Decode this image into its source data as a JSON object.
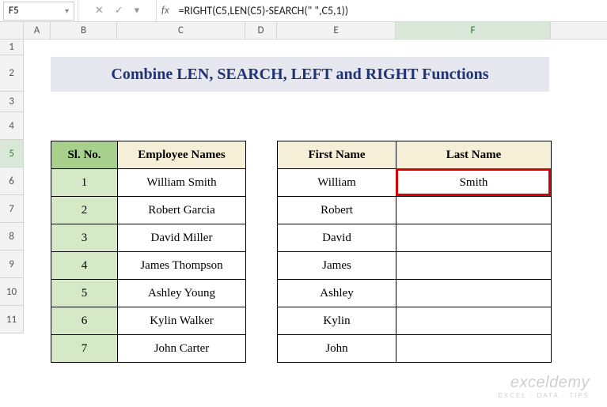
{
  "name_box": "F5",
  "formula": "=RIGHT(C5,LEN(C5)-SEARCH(\" \",C5,1))",
  "columns": [
    "A",
    "B",
    "C",
    "D",
    "E",
    "F"
  ],
  "active_col_idx": 5,
  "row_numbers": [
    1,
    2,
    3,
    4,
    5,
    6,
    7,
    8,
    9,
    10,
    11
  ],
  "active_row_idx": 4,
  "title": "Combine LEN, SEARCH, LEFT and RIGHT Functions",
  "table1": {
    "headers": {
      "sl": "Sl. No.",
      "name": "Employee Names"
    },
    "rows": [
      {
        "sl": 1,
        "name": "William Smith"
      },
      {
        "sl": 2,
        "name": "Robert Garcia"
      },
      {
        "sl": 3,
        "name": "David Miller"
      },
      {
        "sl": 4,
        "name": "James Thompson"
      },
      {
        "sl": 5,
        "name": "Ashley Young"
      },
      {
        "sl": 6,
        "name": "Kylin Walker"
      },
      {
        "sl": 7,
        "name": "John Carter"
      }
    ]
  },
  "table2": {
    "headers": {
      "first": "First Name",
      "last": "Last Name"
    },
    "rows": [
      {
        "first": "William",
        "last": "Smith"
      },
      {
        "first": "Robert",
        "last": ""
      },
      {
        "first": "David",
        "last": ""
      },
      {
        "first": "James",
        "last": ""
      },
      {
        "first": "Ashley",
        "last": ""
      },
      {
        "first": "Kylin",
        "last": ""
      },
      {
        "first": "John",
        "last": ""
      }
    ]
  },
  "fb_icons": {
    "cancel": "✕",
    "accept": "✓",
    "dd": "▾"
  },
  "fx_label": "fx",
  "watermark": {
    "line1": "exceldemy",
    "line2": "EXCEL · DATA · TIPS"
  }
}
